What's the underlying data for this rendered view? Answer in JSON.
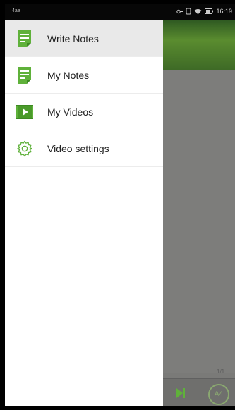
{
  "status_bar": {
    "left_text": "4ae",
    "time": "16:19"
  },
  "drawer": {
    "items": [
      {
        "label": "Write Notes",
        "icon": "note-icon",
        "active": true
      },
      {
        "label": "My Notes",
        "icon": "note-icon",
        "active": false
      },
      {
        "label": "My Videos",
        "icon": "video-icon",
        "active": false
      },
      {
        "label": "Video settings",
        "icon": "gear-icon",
        "active": false
      }
    ]
  },
  "background": {
    "page_indicator": "1/1",
    "font_button_label": "A4"
  },
  "colors": {
    "accent": "#5fb13a",
    "active_bg": "#e9e9e9"
  }
}
